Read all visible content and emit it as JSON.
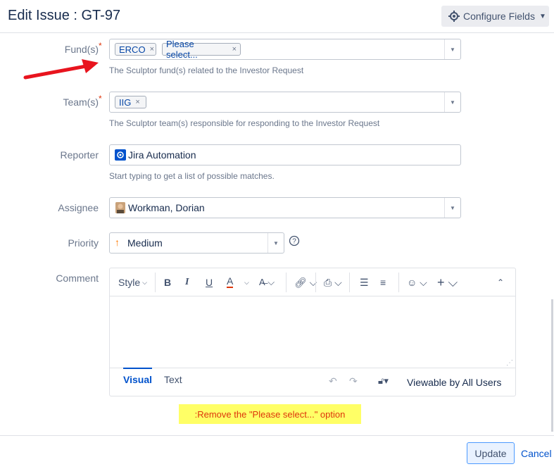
{
  "header": {
    "title": "Edit Issue : GT-97",
    "configure_label": "Configure Fields"
  },
  "funds": {
    "label": "Fund(s)",
    "chips": [
      "ERCO",
      "Please select..."
    ],
    "description": "The Sculptor fund(s) related to the Investor Request"
  },
  "teams": {
    "label": "Team(s)",
    "chips": [
      "IIG"
    ],
    "description": "The Sculptor team(s) responsible for responding to the Investor Request"
  },
  "reporter": {
    "label": "Reporter",
    "value": "Jira Automation",
    "description": "Start typing to get a list of possible matches."
  },
  "assignee": {
    "label": "Assignee",
    "value": "Workman, Dorian"
  },
  "priority": {
    "label": "Priority",
    "value": "Medium"
  },
  "comment": {
    "label": "Comment",
    "style_label": "Style",
    "tabs": [
      "Visual",
      "Text"
    ],
    "visibility": "Viewable by All Users"
  },
  "annotation": {
    "text": ":Remove the \"Please select...\" option",
    "arrow_color": "#e8141e",
    "highlight_color": "#ffff66"
  },
  "footer": {
    "update_label": "Update",
    "cancel_label": "Cancel"
  }
}
